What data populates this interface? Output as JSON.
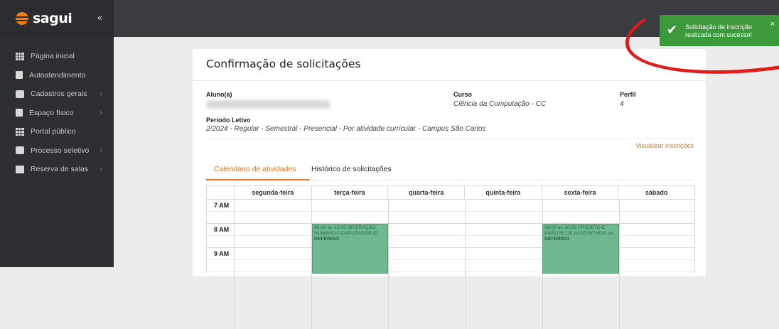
{
  "brand": {
    "name": "sagui",
    "collapse_icon": "«"
  },
  "sidebar": {
    "items": [
      {
        "label": "Página inicial",
        "icon": "grid-icon",
        "has_children": false
      },
      {
        "label": "Autoatendimento",
        "icon": "document-icon",
        "has_children": false
      },
      {
        "label": "Cadastros gerais",
        "icon": "box-icon",
        "has_children": true
      },
      {
        "label": "Espaço físico",
        "icon": "building-icon",
        "has_children": true
      },
      {
        "label": "Portal público",
        "icon": "grid-icon",
        "has_children": false
      },
      {
        "label": "Processo seletivo",
        "icon": "box-icon",
        "has_children": true
      },
      {
        "label": "Reserva de salas",
        "icon": "briefcase-icon",
        "has_children": true
      }
    ],
    "chevron": "›"
  },
  "page": {
    "title": "Confirmação de solicitações",
    "aluno_label": "Aluno(a)",
    "curso_label": "Curso",
    "curso_value": "Ciência da Computação - CC",
    "perfil_label": "Perfil",
    "perfil_value": "4",
    "periodo_label": "Período Letivo",
    "periodo_value": "2/2024 - Regular - Semestral - Presencial - Por atividade curricular - Campus São Carlos",
    "visualizar_link": "Visualizar inscrições"
  },
  "tabs": [
    {
      "label": "Calendário de atividades",
      "active": true
    },
    {
      "label": "Histórico de solicitações",
      "active": false
    }
  ],
  "calendar": {
    "days": [
      "segunda-feira",
      "terça-feira",
      "quarta-feira",
      "quinta-feira",
      "sexta-feira",
      "sábado"
    ],
    "hours": [
      "7 AM",
      "8 AM",
      "9 AM"
    ],
    "events": [
      {
        "time": "08:00 às 10:00",
        "title": "INTERAÇÃO HUMANO-COMPUTADOR (D",
        "status": "DEFERIDO"
      },
      {
        "time": "08:00 às 10:00",
        "title": "PROJETO E ANÁLISE DE ALGORITMOS (A)",
        "status": "DEFERIDO"
      }
    ]
  },
  "toast": {
    "message": "Solicitação de inscrição realizada com sucesso!",
    "close": "×",
    "icon": "check-icon",
    "color": "#3c9a3c"
  },
  "colors": {
    "accent": "#e8761f",
    "sidebar": "#2d2f33",
    "event": "#6fb88f",
    "annotation": "#e01b1b"
  }
}
